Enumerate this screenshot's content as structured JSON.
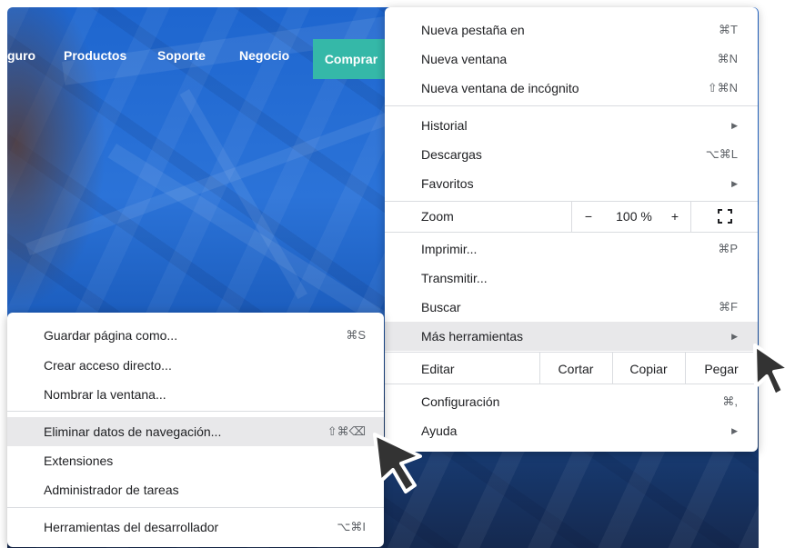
{
  "site": {
    "nav": [
      "guro",
      "Productos",
      "Soporte",
      "Negocio"
    ],
    "buy": "Comprar"
  },
  "main_menu": {
    "items": [
      {
        "label": "Nueva pestaña en",
        "shortcut": "⌘T"
      },
      {
        "label": "Nueva ventana",
        "shortcut": "⌘N"
      },
      {
        "label": "Nueva ventana de incógnito",
        "shortcut": "⇧⌘N"
      },
      {
        "label": "Historial",
        "submenu": true
      },
      {
        "label": "Descargas",
        "shortcut": "⌥⌘L"
      },
      {
        "label": "Favoritos",
        "submenu": true
      },
      {
        "label": "Imprimir...",
        "shortcut": "⌘P"
      },
      {
        "label": "Transmitir...",
        "shortcut": ""
      },
      {
        "label": "Buscar",
        "shortcut": "⌘F"
      },
      {
        "label": "Más herramientas",
        "submenu": true
      },
      {
        "label": "Configuración",
        "shortcut": "⌘,"
      },
      {
        "label": "Ayuda",
        "submenu": true
      }
    ],
    "zoom": {
      "label": "Zoom",
      "minus": "−",
      "value": "100 %",
      "plus": "+"
    },
    "edit": {
      "label": "Editar",
      "cut": "Cortar",
      "copy": "Copiar",
      "paste": "Pegar"
    }
  },
  "sub_menu": {
    "items": [
      {
        "label": "Guardar página como...",
        "shortcut": "⌘S"
      },
      {
        "label": "Crear acceso directo...",
        "shortcut": ""
      },
      {
        "label": "Nombrar la ventana...",
        "shortcut": ""
      },
      {
        "label": "Eliminar datos de navegación...",
        "shortcut": "⇧⌘⌫"
      },
      {
        "label": "Extensiones",
        "shortcut": ""
      },
      {
        "label": "Administrador de tareas",
        "shortcut": ""
      },
      {
        "label": "Herramientas del desarrollador",
        "shortcut": "⌥⌘I"
      }
    ]
  },
  "icons": {
    "submenu_arrow": "▶",
    "fullscreen": "fullscreen-icon",
    "cursor": "cursor-arrow-icon"
  }
}
